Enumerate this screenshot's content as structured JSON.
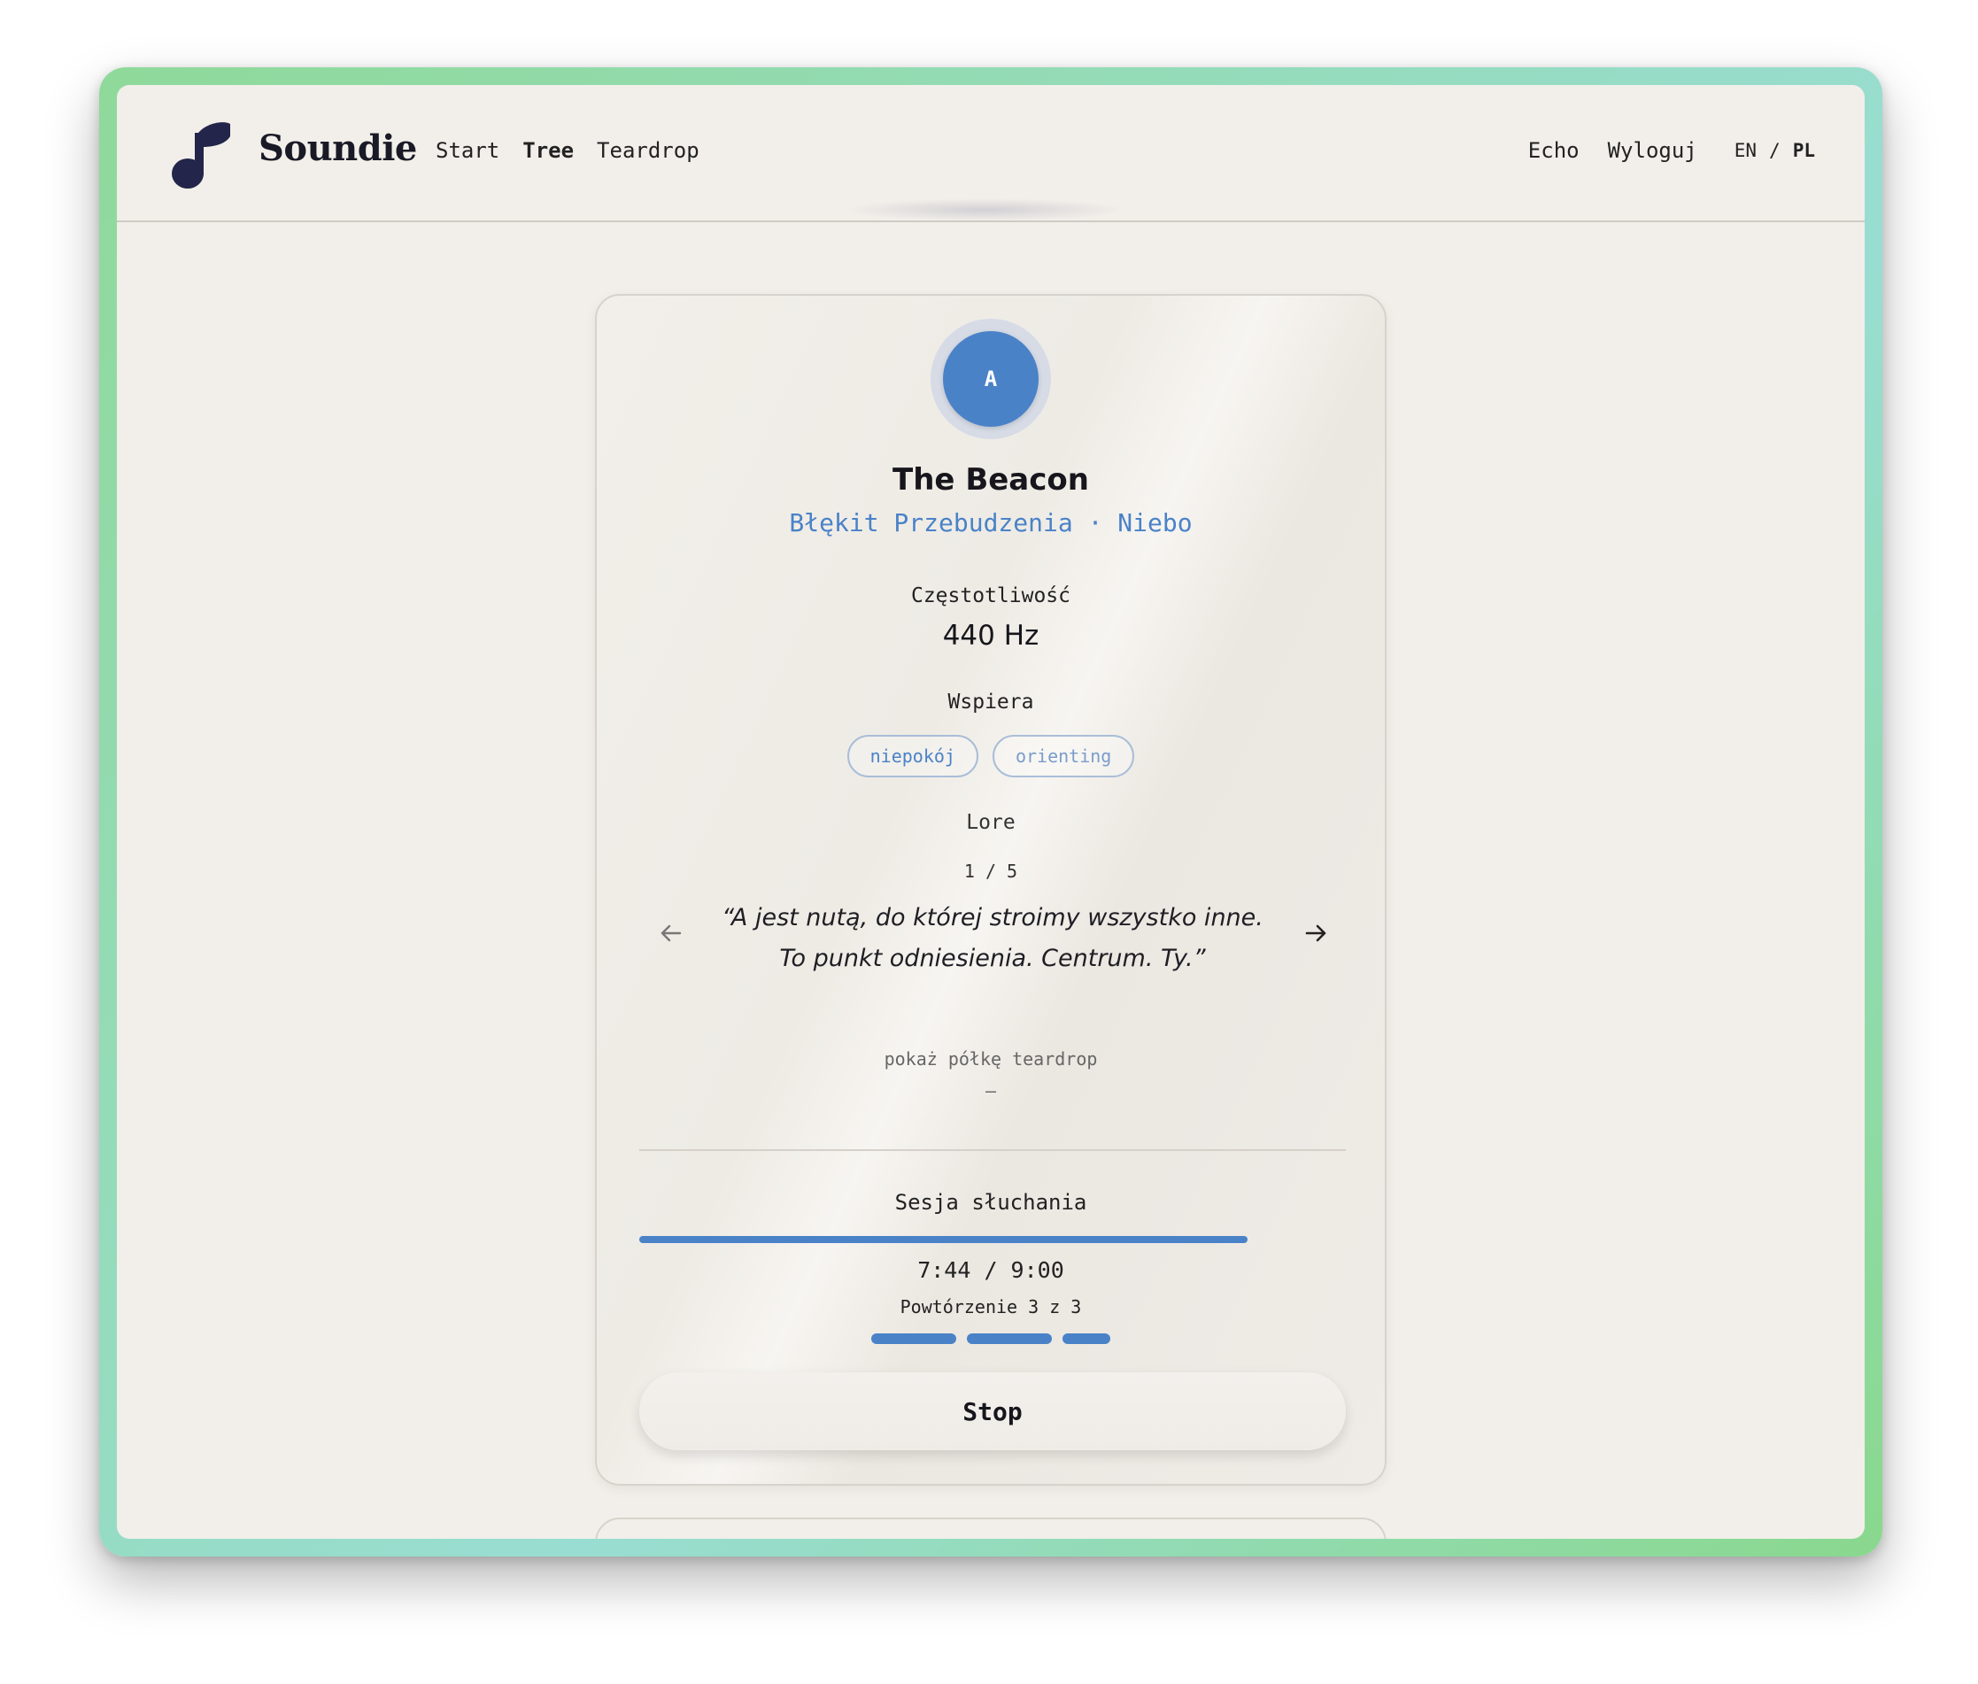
{
  "header": {
    "brand": "Soundie",
    "nav": [
      {
        "label": "Start"
      },
      {
        "label": "Tree"
      },
      {
        "label": "Teardrop"
      }
    ],
    "right_links": [
      {
        "label": "Echo"
      },
      {
        "label": "Wyloguj"
      }
    ],
    "lang": {
      "en": "EN",
      "separator": "/",
      "pl": "PL"
    }
  },
  "card": {
    "avatar_letter": "A",
    "title": "The Beacon",
    "subtitle": "Błękit Przebudzenia · Niebo",
    "frequency_label": "Częstotliwość",
    "frequency_value": "440 Hz",
    "supports_label": "Wspiera",
    "tags": [
      {
        "label": "niepokój"
      },
      {
        "label": "orienting"
      }
    ],
    "lore_label": "Lore",
    "lore_counter": "1 / 5",
    "quote": "“A jest nutą, do której stroimy wszystko inne. To punkt odniesienia. Centrum. Ty.”",
    "shelf_toggle": "pokaż półkę teardrop",
    "shelf_value": "–"
  },
  "session": {
    "label": "Sesja słuchania",
    "progress_fraction": 0.861,
    "time": "7:44 / 9:00",
    "repetition": "Powtórzenie 3 z 3",
    "repetition_fills": [
      1,
      1,
      0.56
    ],
    "stop_label": "Stop"
  },
  "colors": {
    "accent": "#4a82c8",
    "brand_dark": "#23264a",
    "background": "#f2efea",
    "frame_green": "#8fd99a"
  }
}
